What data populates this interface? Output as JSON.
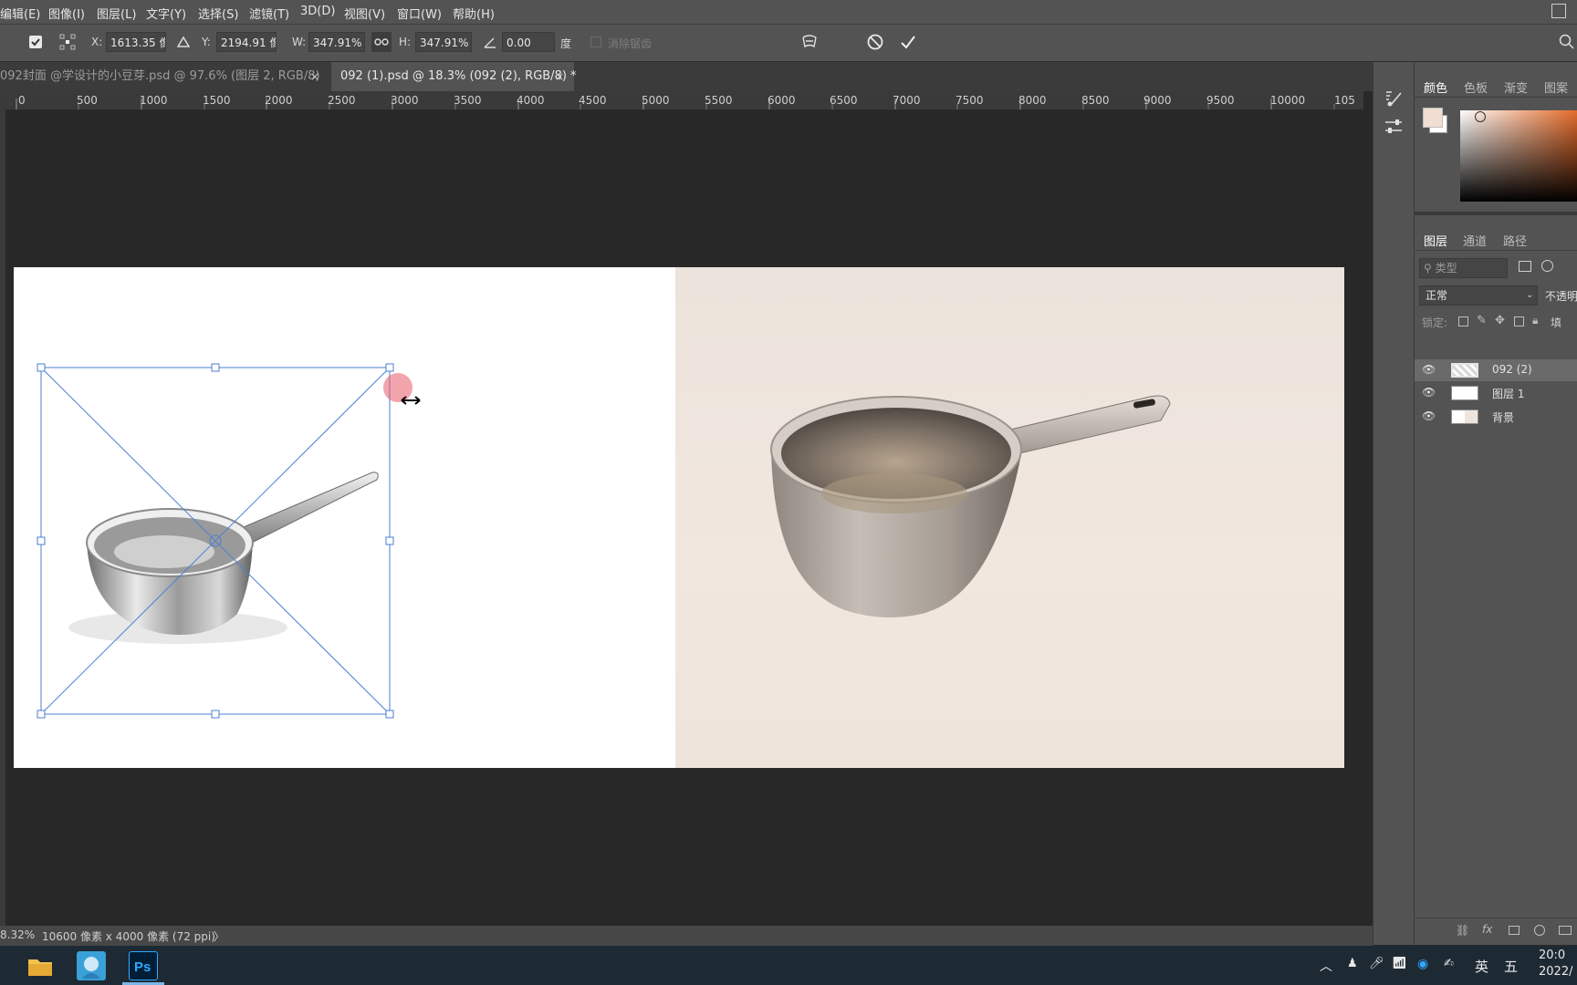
{
  "menu": [
    "编辑(E)",
    "图像(I)",
    "图层(L)",
    "文字(Y)",
    "选择(S)",
    "滤镜(T)",
    "3D(D)",
    "视图(V)",
    "窗口(W)",
    "帮助(H)"
  ],
  "options": {
    "x_label": "X:",
    "x_value": "1613.35 像",
    "y_label": "Y:",
    "y_value": "2194.91 像",
    "w_label": "W:",
    "w_value": "347.91%",
    "h_label": "H:",
    "h_value": "347.91%",
    "angle_value": "0.00",
    "angle_unit": "度",
    "antialias_label": "消除锯齿"
  },
  "tabs": [
    {
      "label": "092封面 @学设计的小豆芽.psd @ 97.6% (图层 2, RGB/8)",
      "close": "×",
      "active": false
    },
    {
      "label": "092 (1).psd @ 18.3% (092 (2), RGB/8) *",
      "close": "×",
      "active": true
    }
  ],
  "ruler_labels": [
    "0",
    "500",
    "1000",
    "1500",
    "2000",
    "2500",
    "3000",
    "3500",
    "4000",
    "4500",
    "5000",
    "5500",
    "6000",
    "6500",
    "7000",
    "7500",
    "8000",
    "8500",
    "9000",
    "9500",
    "10000",
    "105"
  ],
  "status": {
    "zoom": "8.32%",
    "doc_size": "10600 像素 x 4000 像素 (72 ppi)",
    "arrow": "〉"
  },
  "color_panel": {
    "tabs": [
      "颜色",
      "色板",
      "渐变",
      "图案"
    ],
    "foreground": "#f1ddd2",
    "background": "#ffffff"
  },
  "layers_panel": {
    "tabs": [
      "图层",
      "通道",
      "路径"
    ],
    "search_placeholder": "类型",
    "blend_mode": "正常",
    "opacity_label": "不透明",
    "lock_label": "锁定:",
    "fill_label": "填",
    "layers": [
      {
        "name": "092 (2)",
        "selected": true
      },
      {
        "name": "图层 1",
        "selected": false
      },
      {
        "name": "背景",
        "selected": false
      }
    ]
  },
  "taskbar": {
    "ime": "英",
    "ime2": "五",
    "clock_time": "20:0",
    "clock_date": "2022/"
  },
  "colors": {
    "accent_transform": "#4b7fd1",
    "panel_bg": "#535353",
    "workspace": "#282828"
  }
}
